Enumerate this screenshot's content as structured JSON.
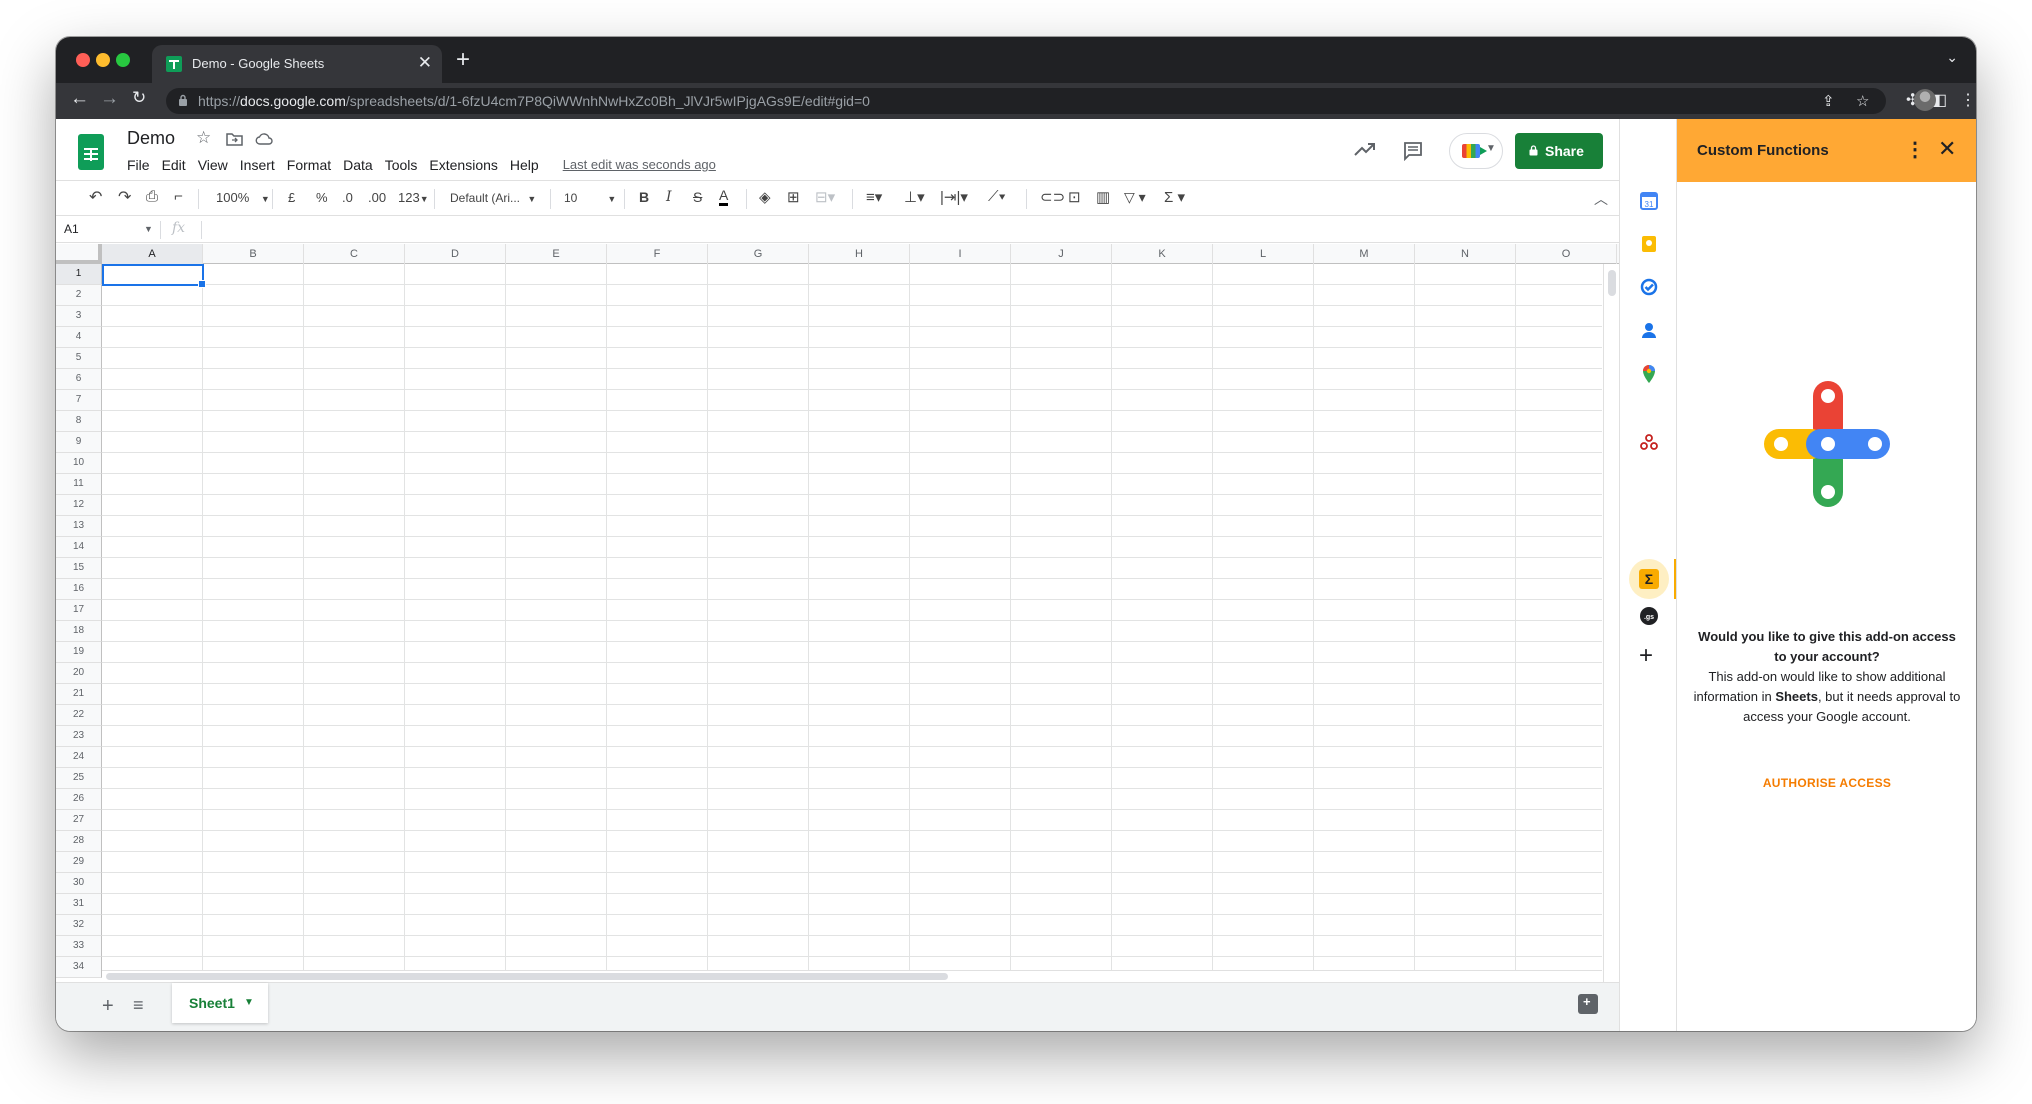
{
  "browser": {
    "tab_title": "Demo - Google Sheets",
    "url_prefix": "https://",
    "url_host": "docs.google.com",
    "url_path": "/spreadsheets/d/1-6fzU4cm7P8QiWWnhNwHxZc0Bh_JlVJr5wIPjgAGs9E/edit#gid=0"
  },
  "header": {
    "doc_title": "Demo",
    "menus": [
      "File",
      "Edit",
      "View",
      "Insert",
      "Format",
      "Data",
      "Tools",
      "Extensions",
      "Help"
    ],
    "last_edit": "Last edit was seconds ago",
    "share_label": "Share"
  },
  "toolbar": {
    "zoom": "100%",
    "currency": "£",
    "percent": "%",
    "decrease_decimal": ".0",
    "increase_decimal": ".00",
    "more_formats": "123",
    "font": "Default (Ari...",
    "font_size": "10",
    "bold": "B",
    "italic": "I",
    "strike": "S",
    "text_color": "A",
    "functions": "Σ"
  },
  "formula_bar": {
    "name_box": "A1",
    "fx": "fx"
  },
  "grid": {
    "columns": [
      "A",
      "B",
      "C",
      "D",
      "E",
      "F",
      "G",
      "H",
      "I",
      "J",
      "K",
      "L",
      "M",
      "N",
      "O"
    ],
    "rows": [
      "1",
      "2",
      "3",
      "4",
      "5",
      "6",
      "7",
      "8",
      "9",
      "10",
      "11",
      "12",
      "13",
      "14",
      "15",
      "16",
      "17",
      "18",
      "19",
      "20",
      "21",
      "22",
      "23",
      "24",
      "25",
      "26",
      "27",
      "28",
      "29",
      "30",
      "31",
      "32",
      "33",
      "34"
    ],
    "selected_cell": "A1"
  },
  "sheets": {
    "active_sheet": "Sheet1"
  },
  "addon_panel": {
    "title": "Custom Functions",
    "question": "Would you like to give this add-on access to your account?",
    "body_before": "This add-on would like to show additional information in ",
    "body_bold": "Sheets",
    "body_after": ", but it needs approval to access your Google account.",
    "authorise_label": "AUTHORISE ACCESS"
  },
  "colors": {
    "sheets_green": "#188038",
    "addon_header": "#ffa834",
    "authorise": "#f57c00",
    "selection_blue": "#1a73e8"
  }
}
